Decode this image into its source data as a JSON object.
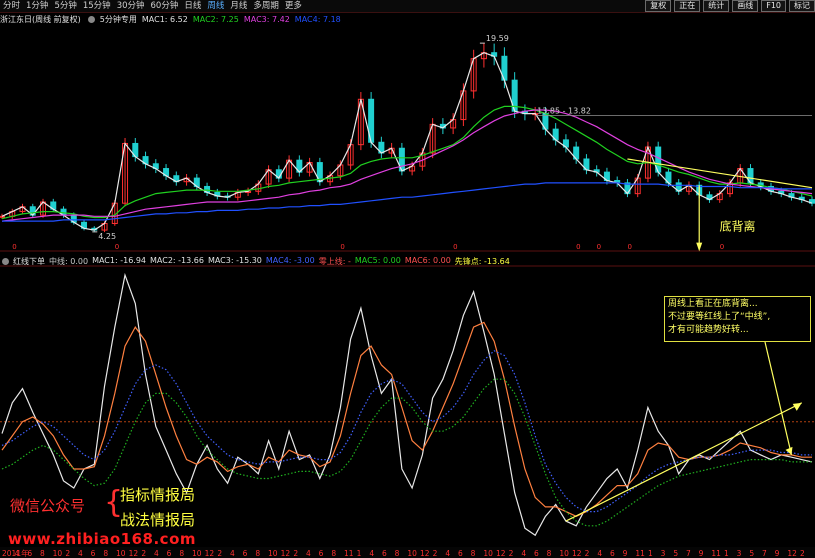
{
  "toolbar": {
    "periods": [
      "分时",
      "1分钟",
      "5分钟",
      "15分钟",
      "30分钟",
      "60分钟",
      "日线",
      "周线",
      "月线",
      "多周期",
      "更多"
    ],
    "active_period": "周线",
    "right_buttons": [
      "复权",
      "正在",
      "统计",
      "画线",
      "F10",
      "标记"
    ]
  },
  "upper_panel": {
    "stock_label": "浙江东日(周线 前复权)",
    "indicator_name": "5分钟专用",
    "mac_values": [
      {
        "label": "MAC1: 6.52",
        "color": "#e0e0e0"
      },
      {
        "label": "MAC2: 7.25",
        "color": "#20d020"
      },
      {
        "label": "MAC3: 7.42",
        "color": "#e040e0"
      },
      {
        "label": "MAC4: 7.18",
        "color": "#2050ff"
      }
    ],
    "annotations": {
      "high": "19.59",
      "low": "4.25",
      "range": "13.85 - 13.82",
      "divergence": "底背离"
    }
  },
  "lower_panel": {
    "indicator_label": "红线下单",
    "values": [
      {
        "label": "中线: 0.00",
        "color": "#c8c8c8"
      },
      {
        "label": "MAC1: -16.94",
        "color": "#e0e0e0"
      },
      {
        "label": "MAC2: -13.66",
        "color": "#e0e0e0"
      },
      {
        "label": "MAC3: -15.30",
        "color": "#e0e0e0"
      },
      {
        "label": "MAC4: -3.00",
        "color": "#4060ff"
      },
      {
        "label": "零上线: -",
        "color": "#ff5050"
      },
      {
        "label": "MAC5: 0.00",
        "color": "#20d020"
      },
      {
        "label": "MAC6: 0.00",
        "color": "#ff5050"
      },
      {
        "label": "先锋点: -13.64",
        "color": "#ffff40"
      }
    ],
    "note_lines": [
      "周线上看正在底背离...",
      "不过要等红线上了“中线”,",
      "才有可能趋势好转..."
    ]
  },
  "watermark": {
    "account_label": "微信公众号",
    "brace": "{",
    "name1": "指标情报局",
    "name2": "战法情报局",
    "url": "www.zhibiao168.com"
  },
  "x_axis": {
    "labels": [
      "2011年",
      "4",
      "6",
      "8",
      "10",
      "2",
      "4",
      "6",
      "8",
      "10",
      "12",
      "2",
      "4",
      "6",
      "8",
      "10",
      "12",
      "2",
      "4",
      "6",
      "8",
      "10",
      "12",
      "2",
      "4",
      "6",
      "8",
      "11",
      "1",
      "4",
      "6",
      "8",
      "10",
      "12",
      "2",
      "4",
      "6",
      "8",
      "10",
      "12",
      "2",
      "4",
      "6",
      "8",
      "10",
      "12",
      "2",
      "4",
      "6",
      "9",
      "11",
      "1",
      "3",
      "5",
      "7",
      "9",
      "11",
      "1",
      "3",
      "5",
      "7",
      "9",
      "12",
      "2"
    ]
  },
  "chart_data": [
    {
      "type": "line",
      "title": "5分钟专用",
      "annotations": [
        "19.59",
        "4.25",
        "13.85 - 13.82",
        "底背离"
      ],
      "series": [
        {
          "name": "MAC1",
          "color": "#e8e8e8",
          "values": [
            5.4,
            5.8,
            6.2,
            5.5,
            6.6,
            6.0,
            5.5,
            4.9,
            4.4,
            4.25,
            4.8,
            6.5,
            11.5,
            10.4,
            9.8,
            9.4,
            8.8,
            8.3,
            8.6,
            7.9,
            7.4,
            7.1,
            7.0,
            7.4,
            7.5,
            8.1,
            9.3,
            8.6,
            10.1,
            9.1,
            9.9,
            8.3,
            8.8,
            9.7,
            11.4,
            15.2,
            11.6,
            10.7,
            11.1,
            9.2,
            9.6,
            10.7,
            13.1,
            12.8,
            13.5,
            15.9,
            18.6,
            19.1,
            18.8,
            16.8,
            14.2,
            14.0,
            14.0,
            12.7,
            11.8,
            11.2,
            10.2,
            9.3,
            9.1,
            8.4,
            8.2,
            7.3,
            8.6,
            11.2,
            9.1,
            8.2,
            7.5,
            8.0,
            7.2,
            6.8,
            7.3,
            8.2,
            9.4,
            8.2,
            7.9,
            7.5,
            7.3,
            7.0,
            6.8,
            6.5
          ]
        },
        {
          "name": "MAC2",
          "color": "#20d020",
          "values": [
            5.2,
            5.4,
            5.6,
            5.7,
            5.8,
            5.8,
            5.7,
            5.6,
            5.4,
            5.3,
            5.3,
            5.5,
            6.3,
            6.7,
            7.0,
            7.3,
            7.4,
            7.5,
            7.6,
            7.6,
            7.6,
            7.5,
            7.5,
            7.5,
            7.6,
            7.7,
            7.9,
            8.0,
            8.2,
            8.3,
            8.4,
            8.5,
            8.6,
            8.7,
            9.0,
            9.7,
            10.0,
            10.2,
            10.3,
            10.3,
            10.3,
            10.5,
            10.8,
            11.1,
            11.4,
            12.0,
            12.9,
            13.7,
            14.3,
            14.6,
            14.6,
            14.5,
            14.3,
            14.0,
            13.6,
            13.1,
            12.6,
            12.1,
            11.6,
            11.0,
            10.5,
            10.0,
            9.8,
            9.9,
            9.7,
            9.4,
            9.1,
            8.9,
            8.6,
            8.3,
            8.1,
            8.1,
            8.2,
            8.1,
            8.0,
            7.8,
            7.7,
            7.5,
            7.3,
            7.1
          ]
        },
        {
          "name": "MAC3",
          "color": "#e040e0",
          "values": [
            5.0,
            5.1,
            5.2,
            5.3,
            5.4,
            5.5,
            5.5,
            5.5,
            5.5,
            5.4,
            5.4,
            5.4,
            5.6,
            5.8,
            6.0,
            6.1,
            6.2,
            6.3,
            6.4,
            6.5,
            6.6,
            6.6,
            6.6,
            6.6,
            6.7,
            6.8,
            6.9,
            7.0,
            7.2,
            7.3,
            7.5,
            7.6,
            7.8,
            7.9,
            8.1,
            8.5,
            8.8,
            9.1,
            9.4,
            9.6,
            9.8,
            10.1,
            10.5,
            10.9,
            11.3,
            11.8,
            12.4,
            12.9,
            13.4,
            13.8,
            14.0,
            14.2,
            14.3,
            14.3,
            14.2,
            14.0,
            13.7,
            13.3,
            12.9,
            12.4,
            11.9,
            11.4,
            11.0,
            10.7,
            10.3,
            9.9,
            9.5,
            9.1,
            8.8,
            8.5,
            8.3,
            8.1,
            8.0,
            7.9,
            7.8,
            7.7,
            7.6,
            7.5,
            7.4,
            7.3
          ]
        },
        {
          "name": "MAC4",
          "color": "#2050ff",
          "values": [
            5.0,
            5.0,
            5.0,
            5.0,
            5.0,
            5.0,
            5.1,
            5.1,
            5.1,
            5.1,
            5.1,
            5.2,
            5.3,
            5.4,
            5.5,
            5.6,
            5.6,
            5.7,
            5.7,
            5.8,
            5.8,
            5.9,
            5.9,
            5.9,
            6.0,
            6.0,
            6.1,
            6.1,
            6.2,
            6.2,
            6.3,
            6.3,
            6.4,
            6.4,
            6.5,
            6.6,
            6.7,
            6.8,
            6.9,
            7.0,
            7.0,
            7.1,
            7.2,
            7.3,
            7.4,
            7.5,
            7.6,
            7.7,
            7.8,
            7.9,
            8.0,
            8.1,
            8.1,
            8.2,
            8.2,
            8.2,
            8.2,
            8.2,
            8.2,
            8.2,
            8.2,
            8.1,
            8.1,
            8.1,
            8.1,
            8.0,
            8.0,
            8.0,
            7.9,
            7.9,
            7.9,
            7.9,
            7.8,
            7.8,
            7.8,
            7.8,
            7.7,
            7.7,
            7.7,
            7.7
          ]
        }
      ],
      "ylim": [
        3,
        21
      ]
    },
    {
      "type": "line",
      "title": "红线下单",
      "series": [
        {
          "name": "MAC1",
          "color": "#e8e8e8",
          "values": [
            -5,
            8,
            14,
            4,
            -5,
            -14,
            -25,
            -28,
            -20,
            -18,
            15,
            40,
            62,
            50,
            20,
            -2,
            -12,
            -22,
            -30,
            -18,
            -10,
            -20,
            -26,
            -15,
            -18,
            -22,
            -8,
            -20,
            -4,
            -16,
            -14,
            -24,
            -14,
            6,
            35,
            48,
            28,
            12,
            18,
            -20,
            -28,
            -14,
            10,
            18,
            30,
            45,
            55,
            38,
            20,
            -5,
            -30,
            -45,
            -48,
            -40,
            -35,
            -42,
            -44,
            -36,
            -30,
            -24,
            -20,
            -28,
            -12,
            6,
            -4,
            -10,
            -22,
            -16,
            -14,
            -16,
            -12,
            -8,
            -4,
            -12,
            -14,
            -16,
            -14,
            -15,
            -16,
            -17
          ]
        },
        {
          "name": "MAC2",
          "color": "#ff8040",
          "values": [
            -12,
            -6,
            0,
            2,
            -1,
            -6,
            -14,
            -20,
            -20,
            -19,
            -6,
            12,
            32,
            40,
            34,
            20,
            6,
            -6,
            -16,
            -18,
            -15,
            -17,
            -21,
            -19,
            -18,
            -20,
            -15,
            -17,
            -12,
            -14,
            -15,
            -19,
            -17,
            -6,
            12,
            28,
            32,
            24,
            20,
            6,
            -8,
            -12,
            -4,
            6,
            16,
            28,
            40,
            42,
            34,
            18,
            -2,
            -20,
            -32,
            -36,
            -36,
            -38,
            -40,
            -38,
            -35,
            -31,
            -27,
            -27,
            -22,
            -12,
            -9,
            -10,
            -15,
            -16,
            -15,
            -15,
            -14,
            -12,
            -9,
            -10,
            -11,
            -13,
            -14,
            -14,
            -15,
            -15
          ]
        },
        {
          "name": "MAC4",
          "color": "#4060ff",
          "values": [
            -10,
            -8,
            -5,
            -2,
            0,
            -2,
            -6,
            -10,
            -14,
            -16,
            -12,
            -4,
            6,
            16,
            22,
            24,
            22,
            16,
            8,
            0,
            -6,
            -10,
            -14,
            -16,
            -17,
            -18,
            -17,
            -17,
            -16,
            -15,
            -15,
            -16,
            -16,
            -13,
            -6,
            4,
            12,
            16,
            18,
            16,
            10,
            4,
            0,
            2,
            6,
            12,
            20,
            26,
            30,
            28,
            20,
            8,
            -6,
            -18,
            -26,
            -32,
            -36,
            -38,
            -38,
            -36,
            -33,
            -30,
            -27,
            -23,
            -20,
            -18,
            -17,
            -16,
            -15,
            -15,
            -14,
            -14,
            -13,
            -12,
            -12,
            -12,
            -13,
            -13,
            -14,
            -14
          ]
        },
        {
          "name": "先锋点",
          "color": "#20b020",
          "values": [
            -20,
            -18,
            -15,
            -12,
            -10,
            -12,
            -16,
            -20,
            -24,
            -27,
            -26,
            -20,
            -10,
            0,
            8,
            12,
            12,
            8,
            2,
            -6,
            -12,
            -16,
            -20,
            -22,
            -23,
            -24,
            -24,
            -23,
            -22,
            -21,
            -21,
            -22,
            -23,
            -21,
            -16,
            -8,
            0,
            6,
            10,
            10,
            6,
            0,
            -4,
            -4,
            -2,
            2,
            8,
            14,
            18,
            18,
            12,
            2,
            -10,
            -22,
            -32,
            -38,
            -42,
            -44,
            -44,
            -42,
            -39,
            -36,
            -33,
            -30,
            -27,
            -25,
            -23,
            -22,
            -21,
            -20,
            -19,
            -18,
            -17,
            -16,
            -16,
            -16,
            -16,
            -17,
            -17,
            -17
          ]
        }
      ],
      "ylim": [
        -50,
        65
      ]
    }
  ]
}
